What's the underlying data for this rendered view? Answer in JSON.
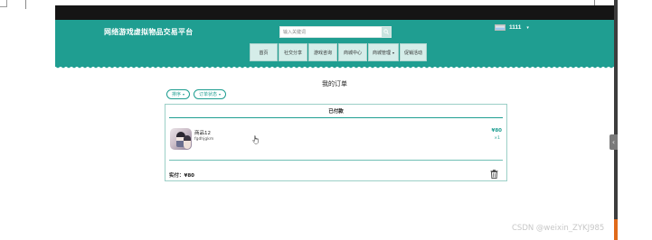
{
  "site": {
    "title": "网络游戏虚拟物品交易平台",
    "search_placeholder": "输入关键词",
    "user_name": "1111",
    "nav": [
      "首页",
      "社交分享",
      "游戏咨询",
      "商城中心",
      "商城管理",
      "促销活动"
    ],
    "accent_color": "#1f9e91"
  },
  "page": {
    "title": "我的订单",
    "filters": [
      "排序",
      "订单状态"
    ]
  },
  "order": {
    "status": "已付款",
    "item_name": "商品12",
    "item_desc": "fgdhjgkm",
    "price": "¥80",
    "quantity": "×1",
    "paid_total": "实付：¥80"
  },
  "icons": [
    "search-icon",
    "flag-icon",
    "chevron-down-icon",
    "trash-icon",
    "hand-cursor-icon"
  ],
  "watermark": "CSDN @weixin_ZYKJ985"
}
